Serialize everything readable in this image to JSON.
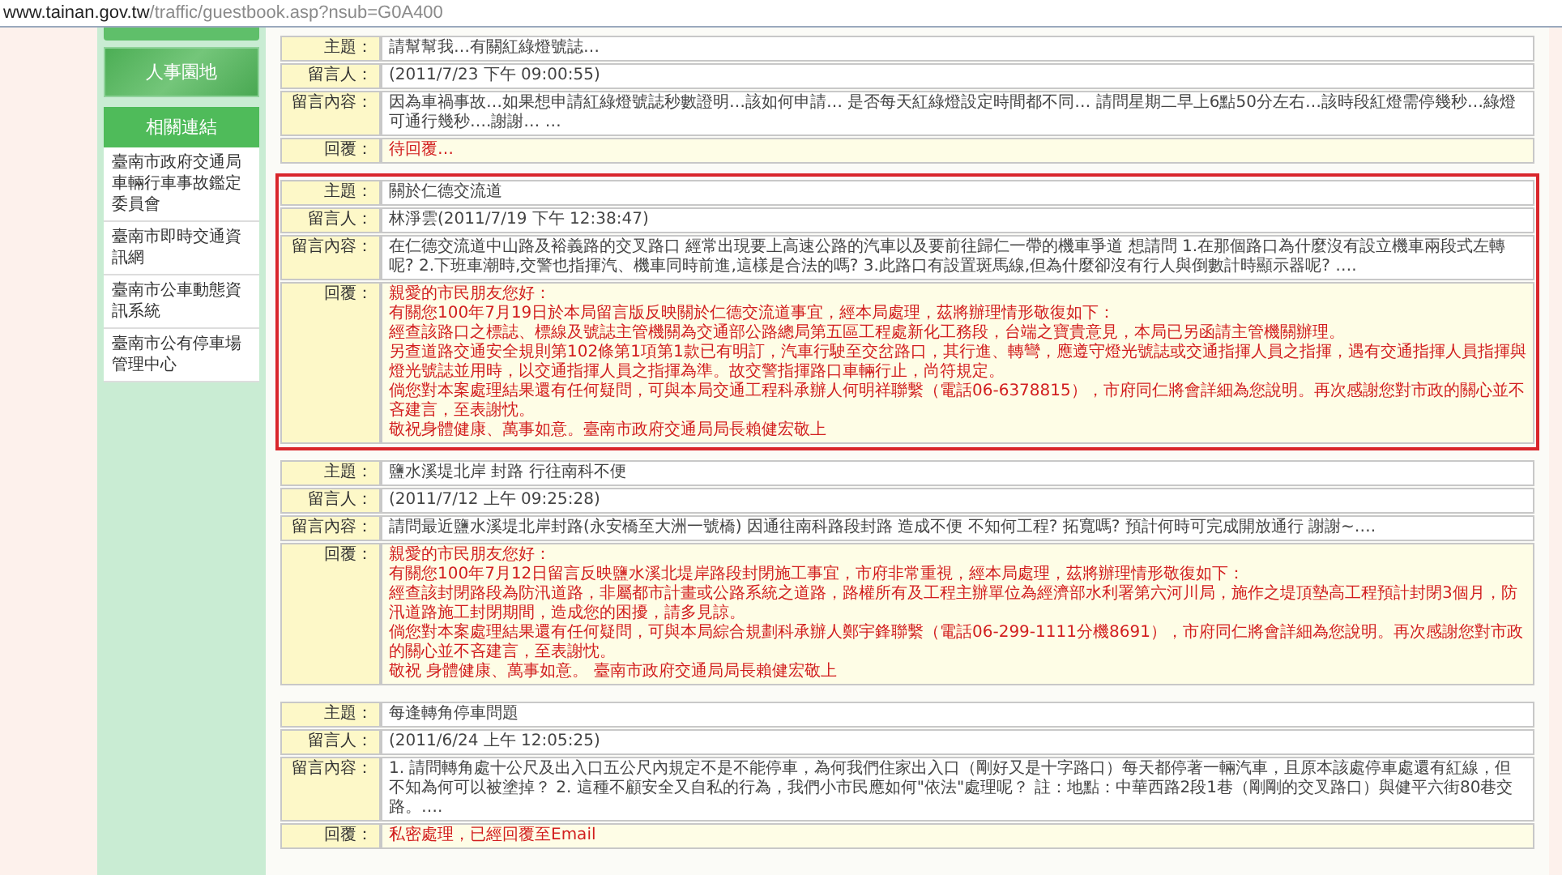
{
  "address_bar": {
    "host": "www.tainan.gov.tw",
    "path": "/traffic/guestbook.asp?nsub=G0A400"
  },
  "sidebar": {
    "banner": "人事園地",
    "links_title": "相關連結",
    "links": [
      {
        "label": "臺南市政府交通局車輛行車事故鑑定委員會"
      },
      {
        "label": "臺南市即時交通資訊網"
      },
      {
        "label": "臺南市公車動態資訊系統"
      },
      {
        "label": "臺南市公有停車場管理中心"
      }
    ]
  },
  "entries": [
    {
      "highlighted": false,
      "subject_label": "主題：",
      "subject": "請幫幫我…有關紅綠燈號誌…",
      "author_label": "留言人：",
      "author": "(2011/7/23 下午 09:00:55)",
      "content_label": "留言內容：",
      "content": "因為車禍事故…如果想申請紅綠燈號誌秒數證明…該如何申請… 是否每天紅綠燈設定時間都不同… 請問星期二早上6點50分左右…該時段紅燈需停幾秒…綠燈可通行幾秒….謝謝… …",
      "reply_label": "回覆：",
      "reply": [
        "待回覆…"
      ]
    },
    {
      "highlighted": true,
      "subject_label": "主題：",
      "subject": "關於仁德交流道",
      "author_label": "留言人：",
      "author": "林淨雲(2011/7/19 下午 12:38:47)",
      "content_label": "留言內容：",
      "content": "在仁德交流道中山路及裕義路的交叉路口 經常出現要上高速公路的汽車以及要前往歸仁一帶的機車爭道 想請問 1.在那個路口為什麼沒有設立機車兩段式左轉呢? 2.下班車潮時,交警也指揮汽、機車同時前進,這樣是合法的嗎? 3.此路口有設置斑馬線,但為什麼卻沒有行人與倒數計時顯示器呢? ….",
      "reply_label": "回覆：",
      "reply": [
        "親愛的市民朋友您好：",
        "有關您100年7月19日於本局留言版反映關於仁德交流道事宜，經本局處理，茲將辦理情形敬復如下：",
        "經查該路口之標誌、標線及號誌主管機關為交通部公路總局第五區工程處新化工務段，台端之寶貴意見，本局已另函請主管機關辦理。",
        "另查道路交通安全規則第102條第1項第1款已有明訂，汽車行駛至交岔路口，其行進、轉彎，應遵守燈光號誌或交通指揮人員之指揮，遇有交通指揮人員指揮與燈光號誌並用時，以交通指揮人員之指揮為準。故交警指揮路口車輛行止，尚符規定。",
        "倘您對本案處理結果還有任何疑問，可與本局交通工程科承辦人何明祥聯繫（電話06-6378815），市府同仁將會詳細為您說明。再次感謝您對市政的關心並不吝建言，至表謝忱。",
        "敬祝身體健康、萬事如意。臺南市政府交通局局長賴健宏敬上"
      ]
    },
    {
      "highlighted": false,
      "subject_label": "主題：",
      "subject": "鹽水溪堤北岸 封路 行往南科不便",
      "author_label": "留言人：",
      "author": "(2011/7/12 上午 09:25:28)",
      "content_label": "留言內容：",
      "content": "請問最近鹽水溪堤北岸封路(永安橋至大洲一號橋) 因通往南科路段封路 造成不便 不知何工程? 拓寬嗎? 預計何時可完成開放通行 謝謝~….",
      "reply_label": "回覆：",
      "reply": [
        "親愛的市民朋友您好：",
        "有關您100年7月12日留言反映鹽水溪北堤岸路段封閉施工事宜，市府非常重視，經本局處理，茲將辦理情形敬復如下：",
        "經查該封閉路段為防汛道路，非屬都市計畫或公路系統之道路，路權所有及工程主辦單位為經濟部水利署第六河川局，施作之堤頂墊高工程預計封閉3個月，防汛道路施工封閉期間，造成您的困擾，請多見諒。",
        "倘您對本案處理結果還有任何疑問，可與本局綜合規劃科承辦人鄭宇鋒聯繫（電話06-299-1111分機8691），市府同仁將會詳細為您說明。再次感謝您對市政的關心並不吝建言，至表謝忱。",
        "敬祝 身體健康、萬事如意。 臺南市政府交通局局長賴健宏敬上"
      ]
    },
    {
      "highlighted": false,
      "subject_label": "主題：",
      "subject": "每逢轉角停車問題",
      "author_label": "留言人：",
      "author": "(2011/6/24 上午 12:05:25)",
      "content_label": "留言內容：",
      "content": "1. 請問轉角處十公尺及出入口五公尺內規定不是不能停車，為何我們住家出入口（剛好又是十字路口）每天都停著一輛汽車，且原本該處停車處還有紅線，但不知為何可以被塗掉？ 2. 這種不顧安全又自私的行為，我們小市民應如何\"依法\"處理呢？ 註：地點：中華西路2段1巷（剛剛的交叉路口）與健平六街80巷交路。….",
      "reply_label": "回覆：",
      "reply": [
        "私密處理，已經回覆至Email"
      ]
    }
  ]
}
